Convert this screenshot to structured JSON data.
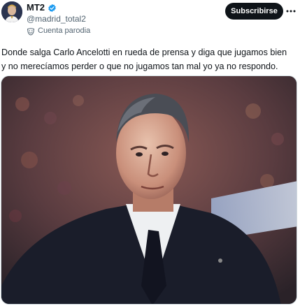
{
  "author": {
    "display_name": "MT2",
    "handle": "@madrid_total2",
    "parody_label": "Cuenta parodia",
    "verified_color": "#1d9bf0",
    "avatar_icon": "avatar-portrait"
  },
  "actions": {
    "subscribe_label": "Subscribirse",
    "more_icon": "more-dots-icon"
  },
  "post": {
    "text_line_1": "Donde salga Carlo Ancelotti en rueda de prensa y diga que jugamos bien",
    "text_line_2": "y no merecíamos perder o que no jugamos tan mal yo ya no respondo."
  },
  "media": {
    "type": "photo",
    "subject": "man-in-suit-portrait"
  },
  "colors": {
    "text_primary": "#0f1419",
    "text_secondary": "#536471",
    "button_bg": "#0f1419",
    "button_text": "#ffffff",
    "accent": "#1d9bf0"
  }
}
